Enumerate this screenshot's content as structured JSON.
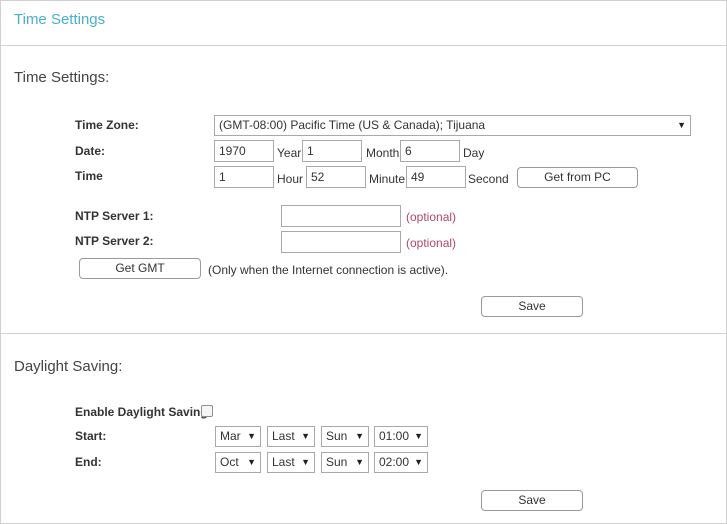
{
  "header": {
    "title": "Time Settings"
  },
  "time_settings": {
    "section_title": "Time Settings:",
    "time_zone": {
      "label": "Time Zone:",
      "selected": "(GMT-08:00) Pacific Time (US & Canada); Tijuana"
    },
    "date": {
      "label": "Date:",
      "year": "1970",
      "year_unit": "Year",
      "month": "1",
      "month_unit": "Month",
      "day": "6",
      "day_unit": "Day"
    },
    "time": {
      "label": "Time",
      "hour": "1",
      "hour_unit": "Hour",
      "minute": "52",
      "minute_unit": "Minute",
      "second": "49",
      "second_unit": "Second",
      "get_from_pc_label": "Get from PC"
    },
    "ntp1": {
      "label": "NTP Server 1:",
      "value": "",
      "hint": "(optional)"
    },
    "ntp2": {
      "label": "NTP Server 2:",
      "value": "",
      "hint": "(optional)"
    },
    "get_gmt_label": "Get GMT",
    "get_gmt_note": "(Only when the Internet connection is active).",
    "save_label": "Save"
  },
  "daylight_saving": {
    "section_title": "Daylight Saving:",
    "enable_label": "Enable Daylight Saving:",
    "enabled": false,
    "start": {
      "label": "Start:",
      "month": "Mar",
      "week": "Last",
      "day": "Sun",
      "time": "01:00"
    },
    "end": {
      "label": "End:",
      "month": "Oct",
      "week": "Last",
      "day": "Sun",
      "time": "02:00"
    },
    "save_label": "Save"
  },
  "icons": {
    "caret": "triangle-down-icon"
  }
}
